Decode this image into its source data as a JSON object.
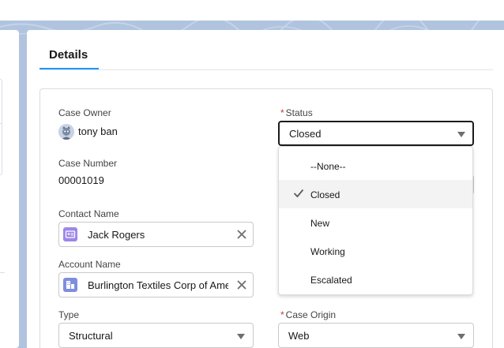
{
  "tabs": [
    {
      "label": "Details"
    }
  ],
  "fields": {
    "case_owner": {
      "label": "Case Owner",
      "value": "tony ban"
    },
    "case_number": {
      "label": "Case Number",
      "value": "00001019"
    },
    "contact_name": {
      "label": "Contact Name",
      "value": "Jack Rogers"
    },
    "account_name": {
      "label": "Account Name",
      "value": "Burlington Textiles Corp of Ame"
    },
    "type": {
      "label": "Type",
      "value": "Structural"
    },
    "status": {
      "required_mark": "*",
      "label": "Status",
      "value": "Closed"
    },
    "case_origin": {
      "required_mark": "*",
      "label": "Case Origin",
      "value": "Web"
    }
  },
  "status_options": [
    {
      "label": "--None--",
      "selected": false
    },
    {
      "label": "Closed",
      "selected": true
    },
    {
      "label": "New",
      "selected": false
    },
    {
      "label": "Working",
      "selected": false
    },
    {
      "label": "Escalated",
      "selected": false
    }
  ],
  "icons": {
    "avatar": "user-avatar",
    "contact": "contact-icon",
    "account": "account-icon",
    "clear": "close-icon",
    "dropdown": "chevron-down-icon",
    "selected": "check-icon"
  },
  "colors": {
    "accent": "#1b96ff",
    "contact_icon": "#9e86e8",
    "account_icon": "#7f8de1",
    "required": "#c23934",
    "banner": "#b0c4df"
  }
}
